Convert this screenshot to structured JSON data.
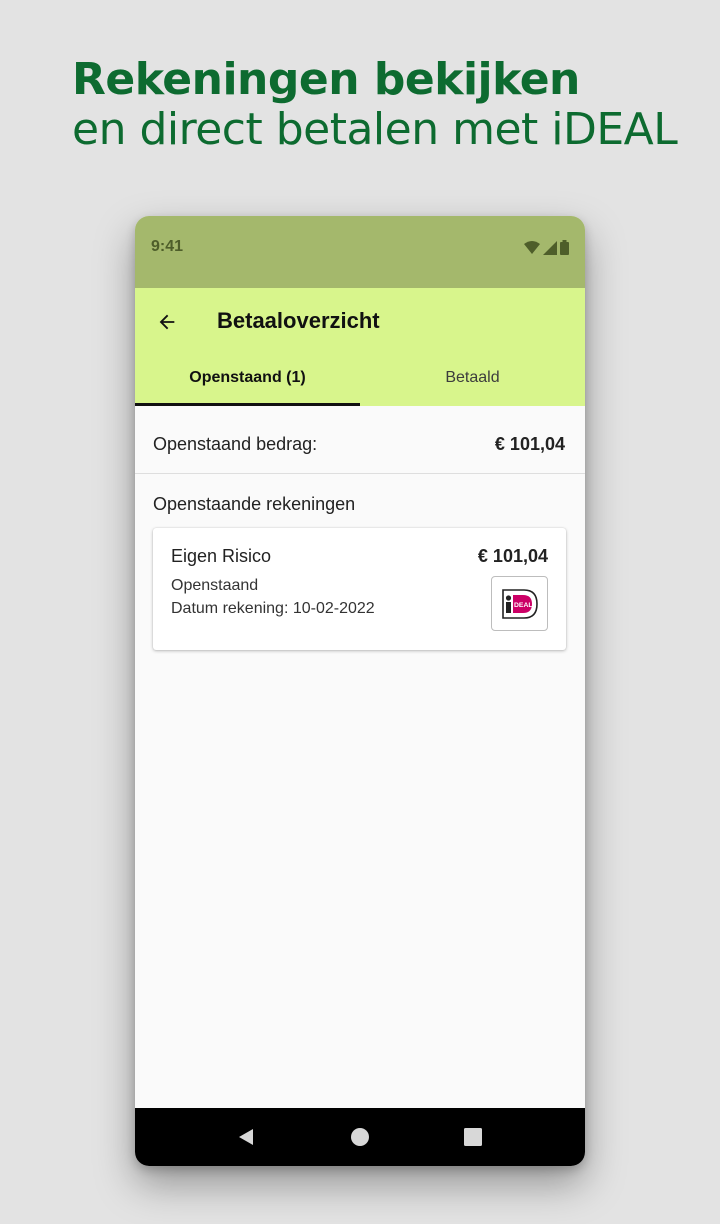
{
  "promo": {
    "title": "Rekeningen bekijken",
    "subtitle": "en direct betalen met iDEAL"
  },
  "status_bar": {
    "time": "9:41",
    "icons": [
      "wifi-icon",
      "signal-icon",
      "battery-icon"
    ]
  },
  "app_bar": {
    "back_icon": "arrow-back-icon",
    "title": "Betaaloverzicht"
  },
  "tabs": [
    {
      "label": "Openstaand (1)",
      "selected": true
    },
    {
      "label": "Betaald",
      "selected": false
    }
  ],
  "summary": {
    "label": "Openstaand bedrag:",
    "amount": "€ 101,04"
  },
  "section": {
    "title": "Openstaande rekeningen"
  },
  "invoices": [
    {
      "name": "Eigen Risico",
      "amount": "€ 101,04",
      "status": "Openstaand",
      "date": "Datum rekening: 10-02-2022",
      "pay_icon": "ideal-logo-icon"
    }
  ],
  "nav": {
    "icons": [
      "back-triangle-icon",
      "home-circle-icon",
      "recents-square-icon"
    ]
  },
  "colors": {
    "brand_green": "#0d6b30",
    "app_bar": "#d8f58c",
    "status_bar": "#a4b86c",
    "ideal_pink": "#cc0066"
  }
}
